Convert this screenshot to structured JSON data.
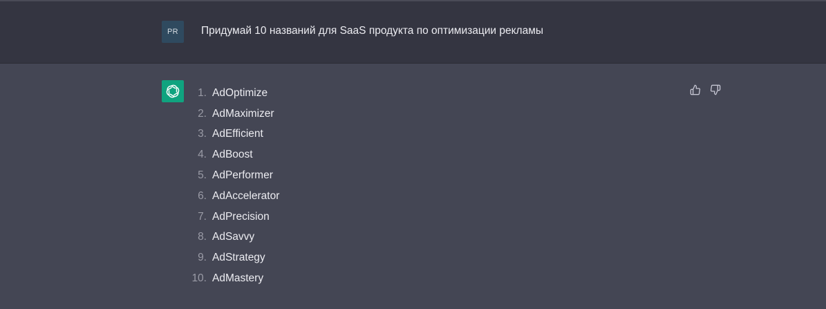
{
  "user_message": {
    "avatar_initials": "PR",
    "text": "Придумай 10 названий для SaaS продукта по оптимизации рекламы"
  },
  "assistant_message": {
    "avatar_icon": "openai-logo-icon",
    "items": [
      {
        "number": "1.",
        "name": "AdOptimize"
      },
      {
        "number": "2.",
        "name": "AdMaximizer"
      },
      {
        "number": "3.",
        "name": "AdEfficient"
      },
      {
        "number": "4.",
        "name": "AdBoost"
      },
      {
        "number": "5.",
        "name": "AdPerformer"
      },
      {
        "number": "6.",
        "name": "AdAccelerator"
      },
      {
        "number": "7.",
        "name": "AdPrecision"
      },
      {
        "number": "8.",
        "name": "AdSavvy"
      },
      {
        "number": "9.",
        "name": "AdStrategy"
      },
      {
        "number": "10.",
        "name": "AdMastery"
      }
    ],
    "feedback_icons": [
      "thumbs-up-icon",
      "thumbs-down-icon"
    ]
  },
  "colors": {
    "user_bg": "#343541",
    "assistant_bg": "#444654",
    "bot_avatar": "#10a37f",
    "user_avatar": "#2f4a5f",
    "text": "#ececf1"
  }
}
